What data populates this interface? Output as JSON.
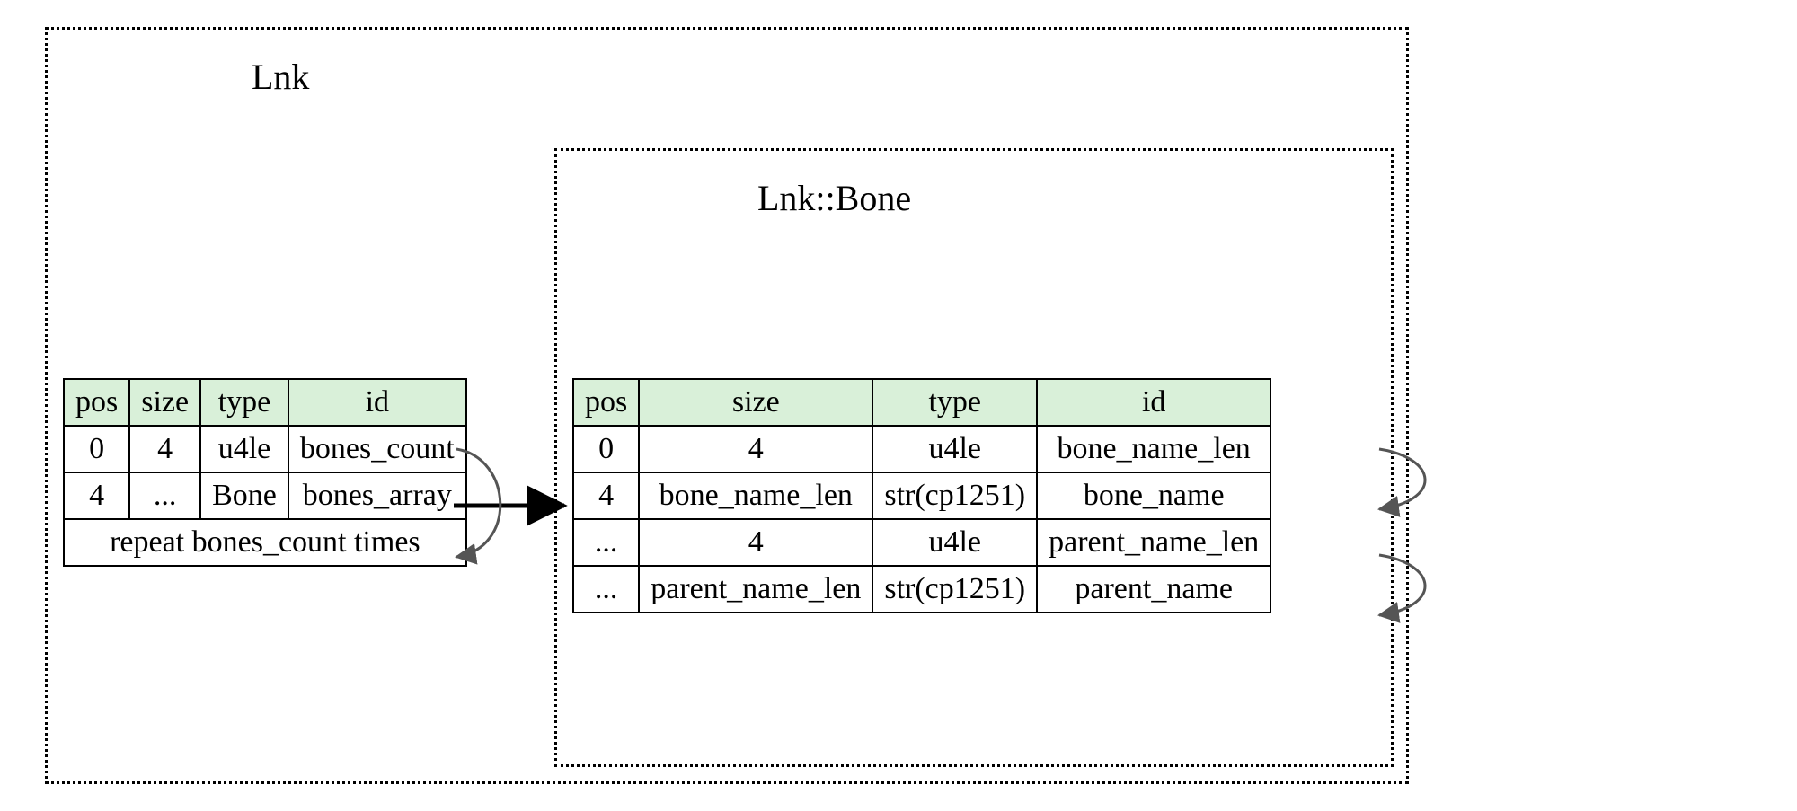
{
  "outer": {
    "title": "Lnk"
  },
  "inner": {
    "title": "Lnk::Bone"
  },
  "table1": {
    "headers": {
      "pos": "pos",
      "size": "size",
      "type": "type",
      "id": "id"
    },
    "rows": [
      {
        "pos": "0",
        "size": "4",
        "type": "u4le",
        "id": "bones_count"
      },
      {
        "pos": "4",
        "size": "...",
        "type": "Bone",
        "id": "bones_array"
      }
    ],
    "footer": "repeat bones_count times"
  },
  "table2": {
    "headers": {
      "pos": "pos",
      "size": "size",
      "type": "type",
      "id": "id"
    },
    "rows": [
      {
        "pos": "0",
        "size": "4",
        "type": "u4le",
        "id": "bone_name_len"
      },
      {
        "pos": "4",
        "size": "bone_name_len",
        "type": "str(cp1251)",
        "id": "bone_name"
      },
      {
        "pos": "...",
        "size": "4",
        "type": "u4le",
        "id": "parent_name_len"
      },
      {
        "pos": "...",
        "size": "parent_name_len",
        "type": "str(cp1251)",
        "id": "parent_name"
      }
    ]
  }
}
